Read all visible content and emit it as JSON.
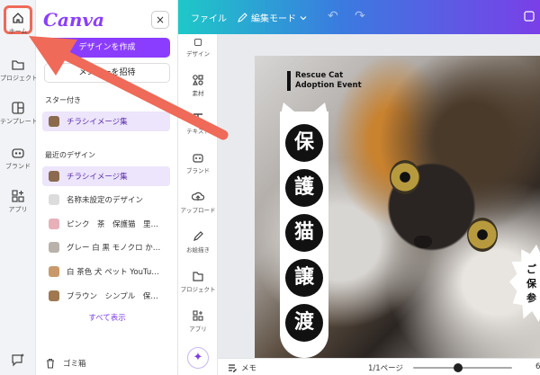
{
  "rail": {
    "items": [
      {
        "icon": "home-icon",
        "label": "ホーム"
      },
      {
        "icon": "folder-icon",
        "label": "プロジェクト"
      },
      {
        "icon": "template-icon",
        "label": "テンプレート"
      },
      {
        "icon": "brand-icon",
        "label": "ブランド"
      },
      {
        "icon": "apps-icon",
        "label": "アプリ"
      }
    ]
  },
  "panel": {
    "logo": "Canva",
    "close": "×",
    "create_button": "デザインを作成",
    "invite_button": "メンバーを招待",
    "starred_title": "スター付き",
    "starred": [
      {
        "label": "チラシイメージ集",
        "color": "#8b6a4e"
      }
    ],
    "recent_title": "最近のデザイン",
    "recent": [
      {
        "label": "チラシイメージ集",
        "color": "#8b6a4e"
      },
      {
        "label": "名称未設定のデザイン",
        "color": "#dcdcdc"
      },
      {
        "label": "ピンク　茶　保護猫　里…",
        "color": "#e8b0b8"
      },
      {
        "label": "グレー 白 黒 モノクロ か…",
        "color": "#b8b2aa"
      },
      {
        "label": "白 茶色 犬 ペット YouTu…",
        "color": "#c89a6a"
      },
      {
        "label": "ブラウン　シンプル　保…",
        "color": "#a07850"
      }
    ],
    "show_all": "すべて表示",
    "trash": "ゴミ箱"
  },
  "topbar": {
    "file": "ファイル",
    "mode": "編集モード",
    "undo": "↶",
    "redo": "↷"
  },
  "tools": [
    {
      "icon": "design-icon",
      "label": "デザイン"
    },
    {
      "icon": "elements-icon",
      "label": "素材"
    },
    {
      "icon": "text-icon",
      "label": "テキスト"
    },
    {
      "icon": "brand-icon",
      "label": "ブランド"
    },
    {
      "icon": "upload-icon",
      "label": "アップロード"
    },
    {
      "icon": "draw-icon",
      "label": "お絵描き"
    },
    {
      "icon": "project-icon",
      "label": "プロジェクト"
    },
    {
      "icon": "apps-icon",
      "label": "アプリ"
    }
  ],
  "design": {
    "event_line1": "Rescue Cat",
    "event_line2": "Adoption Event",
    "kanji": [
      "保",
      "護",
      "猫",
      "譲",
      "渡"
    ],
    "burst_text": "ご保参"
  },
  "bottombar": {
    "memo": "メモ",
    "pages": "1/1ページ",
    "zoom": "6",
    "zoom_level": 0.45
  },
  "colors": {
    "accent": "#8b3dff",
    "annotation": "#ef6a58"
  }
}
